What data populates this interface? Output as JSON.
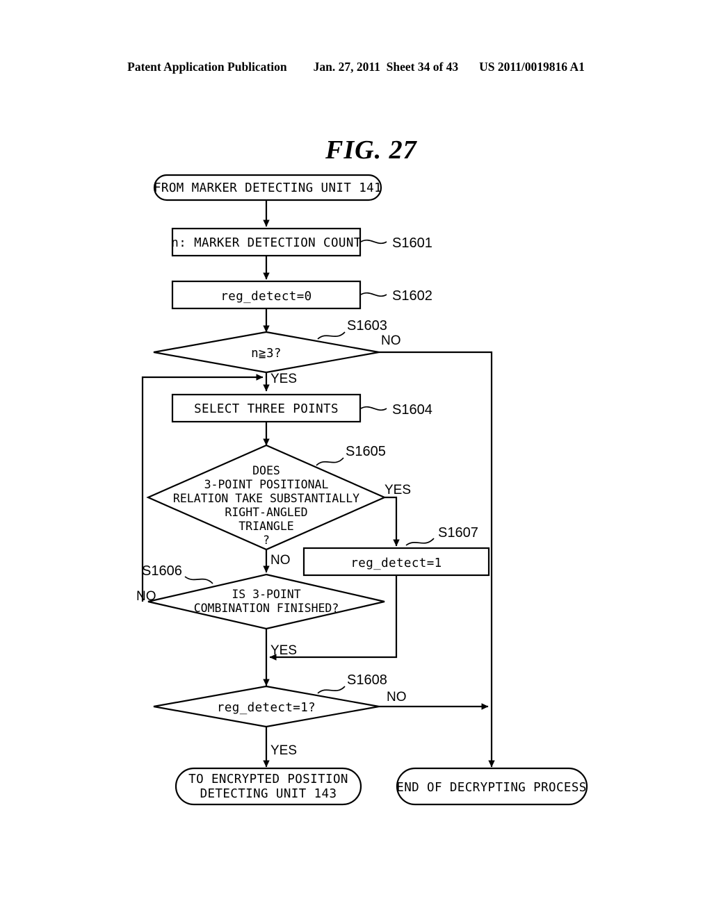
{
  "header": {
    "publication": "Patent Application Publication",
    "date": "Jan. 27, 2011",
    "sheet": "Sheet 34 of 43",
    "docnumber": "US 2011/0019816 A1"
  },
  "figure": {
    "title": "FIG. 27"
  },
  "flowchart": {
    "type": "flowchart",
    "nodes": [
      {
        "id": "start",
        "shape": "terminal",
        "text": "FROM MARKER DETECTING UNIT 141",
        "step": ""
      },
      {
        "id": "s1601",
        "shape": "process",
        "text": "n: MARKER DETECTION COUNT",
        "step": "S1601"
      },
      {
        "id": "s1602",
        "shape": "process",
        "text": "reg_detect=0",
        "step": "S1602"
      },
      {
        "id": "s1603",
        "shape": "decision",
        "text": "n≧3?",
        "step": "S1603"
      },
      {
        "id": "s1604",
        "shape": "process",
        "text": "SELECT THREE POINTS",
        "step": "S1604"
      },
      {
        "id": "s1605",
        "shape": "decision",
        "text": "DOES 3-POINT POSITIONAL RELATION TAKE SUBSTANTIALLY RIGHT-ANGLED TRIANGLE ?",
        "lines": [
          "DOES",
          "3-POINT POSITIONAL",
          "RELATION TAKE SUBSTANTIALLY",
          "RIGHT-ANGLED",
          "TRIANGLE",
          "?"
        ],
        "step": "S1605"
      },
      {
        "id": "s1607",
        "shape": "process",
        "text": "reg_detect=1",
        "step": "S1607"
      },
      {
        "id": "s1606",
        "shape": "decision",
        "text": "IS 3-POINT COMBINATION FINISHED?",
        "lines": [
          "IS 3-POINT",
          "COMBINATION FINISHED?"
        ],
        "step": "S1606"
      },
      {
        "id": "s1608",
        "shape": "decision",
        "text": "reg_detect=1?",
        "step": "S1608"
      },
      {
        "id": "end_yes",
        "shape": "terminal",
        "text": "TO ENCRYPTED POSITION DETECTING UNIT 143",
        "lines": [
          "TO ENCRYPTED POSITION",
          "DETECTING UNIT 143"
        ],
        "step": ""
      },
      {
        "id": "end_no",
        "shape": "terminal",
        "text": "END OF DECRYPTING PROCESS",
        "step": ""
      }
    ],
    "edge_labels": {
      "s1603_no": "NO",
      "s1603_yes": "YES",
      "s1605_yes": "YES",
      "s1605_no": "NO",
      "s1606_no": "NO",
      "s1606_yes": "YES",
      "s1608_no": "NO",
      "s1608_yes": "YES"
    },
    "steps": {
      "s1601": "S1601",
      "s1602": "S1602",
      "s1603": "S1603",
      "s1604": "S1604",
      "s1605": "S1605",
      "s1606": "S1606",
      "s1607": "S1607",
      "s1608": "S1608"
    },
    "colors": {
      "stroke": "#000000",
      "fill": "#ffffff",
      "text": "#000000"
    }
  }
}
